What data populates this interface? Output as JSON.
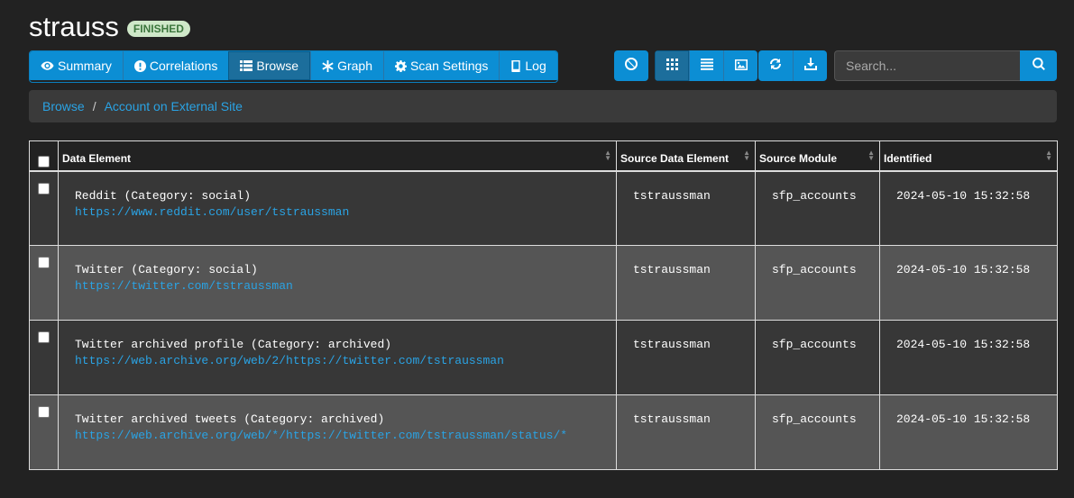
{
  "scan": {
    "name": "strauss",
    "status": "FINISHED"
  },
  "nav": {
    "summary": "Summary",
    "correlations": "Correlations",
    "browse": "Browse",
    "graph": "Graph",
    "scan_settings": "Scan Settings",
    "log": "Log"
  },
  "search": {
    "placeholder": "Search..."
  },
  "breadcrumb": {
    "root": "Browse",
    "separator": "/",
    "current": "Account on External Site"
  },
  "table": {
    "headers": [
      "Data Element",
      "Source Data Element",
      "Source Module",
      "Identified"
    ],
    "rows": [
      {
        "element": "Reddit (Category: social)",
        "url": "https://www.reddit.com/user/tstraussman",
        "source": "tstraussman",
        "module": "sfp_accounts",
        "identified": "2024-05-10 15:32:58"
      },
      {
        "element": "Twitter (Category: social)",
        "url": "https://twitter.com/tstraussman",
        "source": "tstraussman",
        "module": "sfp_accounts",
        "identified": "2024-05-10 15:32:58"
      },
      {
        "element": "Twitter archived profile (Category: archived)",
        "url": "https://web.archive.org/web/2/https://twitter.com/tstraussman",
        "source": "tstraussman",
        "module": "sfp_accounts",
        "identified": "2024-05-10 15:32:58"
      },
      {
        "element": "Twitter archived tweets (Category: archived)",
        "url": "https://web.archive.org/web/*/https://twitter.com/tstraussman/status/*",
        "source": "tstraussman",
        "module": "sfp_accounts",
        "identified": "2024-05-10 15:32:58"
      }
    ]
  },
  "icons": {
    "summary": "eye-icon",
    "correlations": "exclamation-circle-icon",
    "browse": "list-icon",
    "graph": "asterisk-icon",
    "scan_settings": "gear-icon",
    "log": "book-icon",
    "toolbar": [
      "ban-icon",
      "grid-icon",
      "list-view-icon",
      "image-icon",
      "refresh-icon",
      "download-icon",
      "search-icon"
    ]
  },
  "colors": {
    "accent": "#0c8ed4",
    "link": "#2aa3e4",
    "badge_bg": "#cfe8c9",
    "badge_text": "#3c763d",
    "background": "#222222"
  }
}
